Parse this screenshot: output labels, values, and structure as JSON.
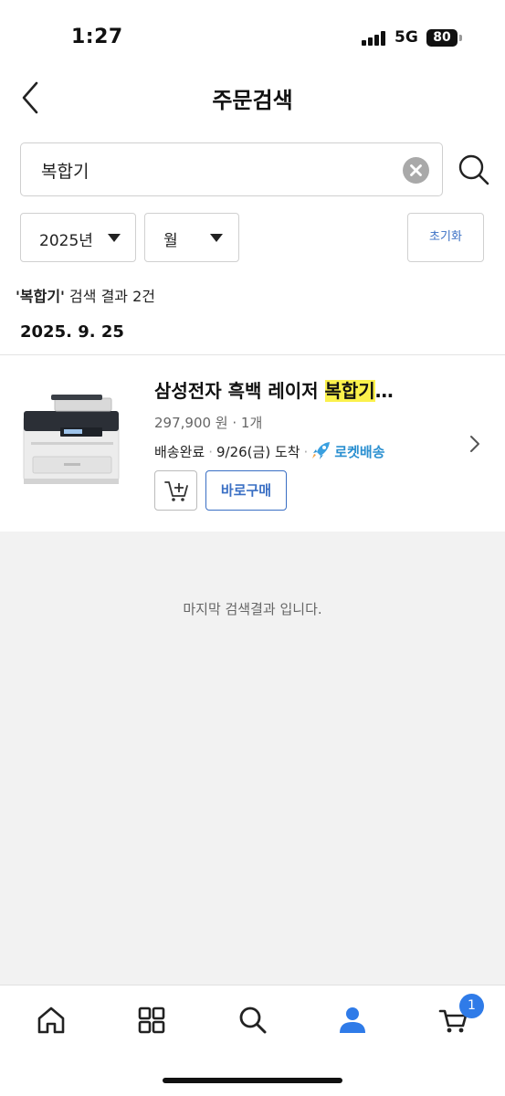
{
  "status_bar": {
    "time": "1:27",
    "network": "5G",
    "battery": "80"
  },
  "header": {
    "title": "주문검색"
  },
  "search": {
    "value": "복합기",
    "placeholder": ""
  },
  "filters": {
    "year": "2025년",
    "month": "월",
    "reset_label": "초기화"
  },
  "summary": {
    "keyword": "'복합기'",
    "text": " 검색 결과 2건"
  },
  "order": {
    "date": "2025. 9. 25",
    "item": {
      "name_prefix": "삼성전자 흑백 레이저 ",
      "name_highlight": "복합기",
      "name_suffix": "…",
      "price_qty": "297,900 원 · 1개",
      "status": "배송완료",
      "arrival": "9/26(금) 도착",
      "delivery_badge": "로켓배송",
      "buy_now_label": "바로구매"
    }
  },
  "end_message": "마지막 검색결과 입니다.",
  "bottom_nav": {
    "items": [
      "home-icon",
      "category-icon",
      "search-icon",
      "my-page-icon",
      "cart-icon"
    ],
    "cart_count": "1"
  },
  "colors": {
    "accent": "#3a6fc4",
    "highlight": "#fbf14c",
    "rocket": "#2a8fd0",
    "badge": "#2f7be8"
  }
}
